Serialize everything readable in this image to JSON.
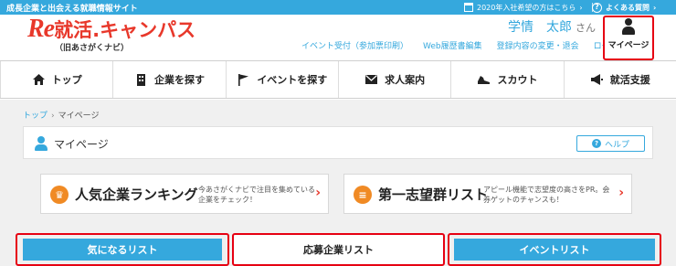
{
  "topbar": {
    "tagline": "成長企業と出会える就職情報サイト",
    "announce": "2020年入社希望の方はこちら",
    "announce_arrow": "›",
    "faq": "よくある質問",
    "faq_arrow": "›",
    "help_glyph": "?"
  },
  "logo": {
    "mark": "Re",
    "name": "就活.キャンパス",
    "subtitle": "（旧あさがくナビ）"
  },
  "user": {
    "name": "学情　太郎",
    "honorific": "さん"
  },
  "subnav": [
    "イベント受付（参加票印刷）",
    "Web履歴書編集",
    "登録内容の変更・退会",
    "ログアウト"
  ],
  "mypage_button": {
    "label": "マイページ"
  },
  "mainnav": [
    {
      "label": "トップ",
      "icon": "home-icon"
    },
    {
      "label": "企業を探す",
      "icon": "building-icon"
    },
    {
      "label": "イベントを探す",
      "icon": "flag-icon"
    },
    {
      "label": "求人案内",
      "icon": "mail-icon"
    },
    {
      "label": "スカウト",
      "icon": "shoe-icon"
    },
    {
      "label": "就活支援",
      "icon": "megaphone-icon"
    }
  ],
  "breadcrumb": {
    "home": "トップ",
    "separator": "›",
    "current": "マイページ"
  },
  "panel": {
    "title": "マイページ",
    "help_label": "ヘルプ",
    "help_glyph": "?"
  },
  "banners": [
    {
      "title": "人気企業ランキング",
      "desc": "今あさがくナビで注目を集めている企業をチェック！",
      "icon": "crown-icon",
      "icon_glyph": "♛",
      "chevron": "›"
    },
    {
      "title": "第一志望群リスト",
      "desc": "アピール機能で志望度の高さをPR。会券ゲットのチャンスも！",
      "icon": "list-icon",
      "icon_glyph": "≡",
      "chevron": "›"
    }
  ],
  "tabs": [
    {
      "label": "気になるリスト"
    },
    {
      "label": "応募企業リスト"
    },
    {
      "label": "イベントリスト"
    }
  ],
  "colors": {
    "accent_blue": "#35a8dd",
    "brand_red": "#e8382b",
    "highlight_red": "#e60012",
    "banner_orange": "#f08a24"
  }
}
